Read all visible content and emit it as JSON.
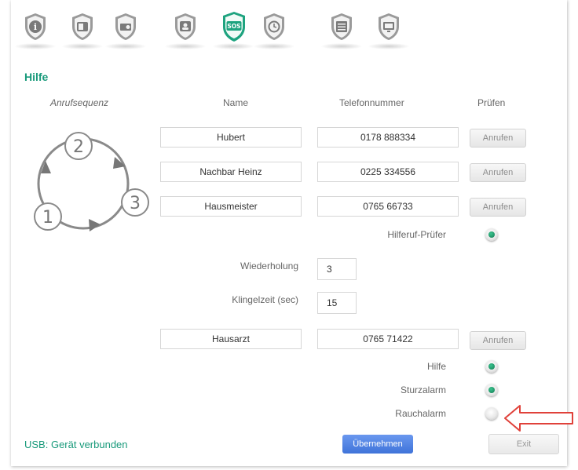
{
  "toolbar": {
    "icons": [
      {
        "name": "info-icon",
        "glyph": "i"
      },
      {
        "name": "contacts-icon",
        "glyph": "☎"
      },
      {
        "name": "device-icon",
        "glyph": "⚙"
      },
      {
        "name": "user-icon",
        "glyph": "◉"
      },
      {
        "name": "sos-icon",
        "glyph": "SOS"
      },
      {
        "name": "alarm-clock-icon",
        "glyph": "⏰"
      },
      {
        "name": "settings-list-icon",
        "glyph": "≡"
      },
      {
        "name": "monitor-icon",
        "glyph": "▭"
      }
    ],
    "active_color": "#1ea37f",
    "inactive_color": "#8f8f8f"
  },
  "page": {
    "title": "Hilfe"
  },
  "sequence": {
    "label": "Anrufsequenz",
    "nodes": [
      "1",
      "2",
      "3"
    ]
  },
  "columns": {
    "name": "Name",
    "phone": "Telefonnummer",
    "check": "Prüfen"
  },
  "contacts": [
    {
      "name": "Hubert",
      "phone": "0178 888334",
      "button": "Anrufen"
    },
    {
      "name": "Nachbar Heinz",
      "phone": "0225 334556",
      "button": "Anrufen"
    },
    {
      "name": "Hausmeister",
      "phone": "0765 66733",
      "button": "Anrufen"
    }
  ],
  "helpcheck": {
    "label": "Hilferuf-Prüfer",
    "checked": true
  },
  "repeat": {
    "label": "Wiederholung",
    "value": "3"
  },
  "ringtime": {
    "label": "Klingelzeit (sec)",
    "value": "15"
  },
  "doctor": {
    "name": "Hausarzt",
    "phone": "0765 71422",
    "button": "Anrufen"
  },
  "options": [
    {
      "label": "Hilfe",
      "checked": true
    },
    {
      "label": "Sturzalarm",
      "checked": true
    },
    {
      "label": "Rauchalarm",
      "checked": false
    }
  ],
  "status": {
    "text": "USB: Gerät verbunden",
    "color": "#199a7b"
  },
  "buttons": {
    "apply": "Übernehmen",
    "exit": "Exit"
  },
  "annotation": {
    "color": "#e0413a"
  }
}
